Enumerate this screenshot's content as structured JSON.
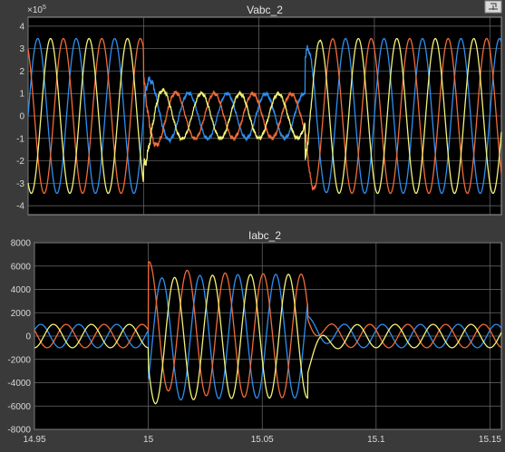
{
  "window": {
    "restore_icon": "restore-window-icon"
  },
  "colors": {
    "background": "#3a3a3a",
    "plot_bg": "#000000",
    "grid": "#6e6e6e",
    "text": "#d8d8d8",
    "blue": "#2e8ff0",
    "orange": "#f26b38",
    "yellow": "#f3f37a"
  },
  "chart_data": [
    {
      "type": "line",
      "title": "Vabc_2",
      "multiplier_label": "×10",
      "multiplier_exp": "5",
      "xlim": [
        14.95,
        15.155
      ],
      "ylim": [
        -4.4,
        4.4
      ],
      "yticks": [
        -4,
        -3,
        -2,
        -1,
        0,
        1,
        2,
        3,
        4
      ],
      "yticklabels": [
        "-4",
        "-3",
        "-2",
        "-1",
        "0",
        "1",
        "2",
        "3",
        "4"
      ],
      "xticks": [
        14.95,
        15,
        15.05,
        15.1,
        15.15
      ],
      "grid": true,
      "frequency_hz": 60,
      "fault_start": 15.0,
      "fault_end": 15.07,
      "prefault_amplitude": 3.45,
      "fault_amplitude": 1.0,
      "postfault_amplitude": 3.45,
      "series": [
        {
          "color": "#2e8ff0",
          "phase_deg": 0
        },
        {
          "color": "#f26b38",
          "phase_deg": 120
        },
        {
          "color": "#f3f37a",
          "phase_deg": -120
        }
      ]
    },
    {
      "type": "line",
      "title": "Iabc_2",
      "xlim": [
        14.95,
        15.155
      ],
      "ylim": [
        -8000,
        8000
      ],
      "yticks": [
        -8000,
        -6000,
        -4000,
        -2000,
        0,
        2000,
        4000,
        6000,
        8000
      ],
      "yticklabels": [
        "-8000",
        "-6000",
        "-4000",
        "-2000",
        "0",
        "2000",
        "4000",
        "6000",
        "8000"
      ],
      "xticks": [
        14.95,
        15,
        15.05,
        15.1,
        15.15
      ],
      "xticklabels": [
        "14.95",
        "15",
        "15.05",
        "15.1",
        "15.15"
      ],
      "grid": true,
      "frequency_hz": 60,
      "fault_start": 15.0,
      "fault_end": 15.07,
      "prefault_amplitude": 1000,
      "fault_amplitude": 5300,
      "dc_offset_peak": 6400,
      "postfault_amplitude": 1000,
      "series": [
        {
          "color": "#2e8ff0",
          "phase_deg": 30
        },
        {
          "color": "#f26b38",
          "phase_deg": 150
        },
        {
          "color": "#f3f37a",
          "phase_deg": -90
        }
      ]
    }
  ]
}
